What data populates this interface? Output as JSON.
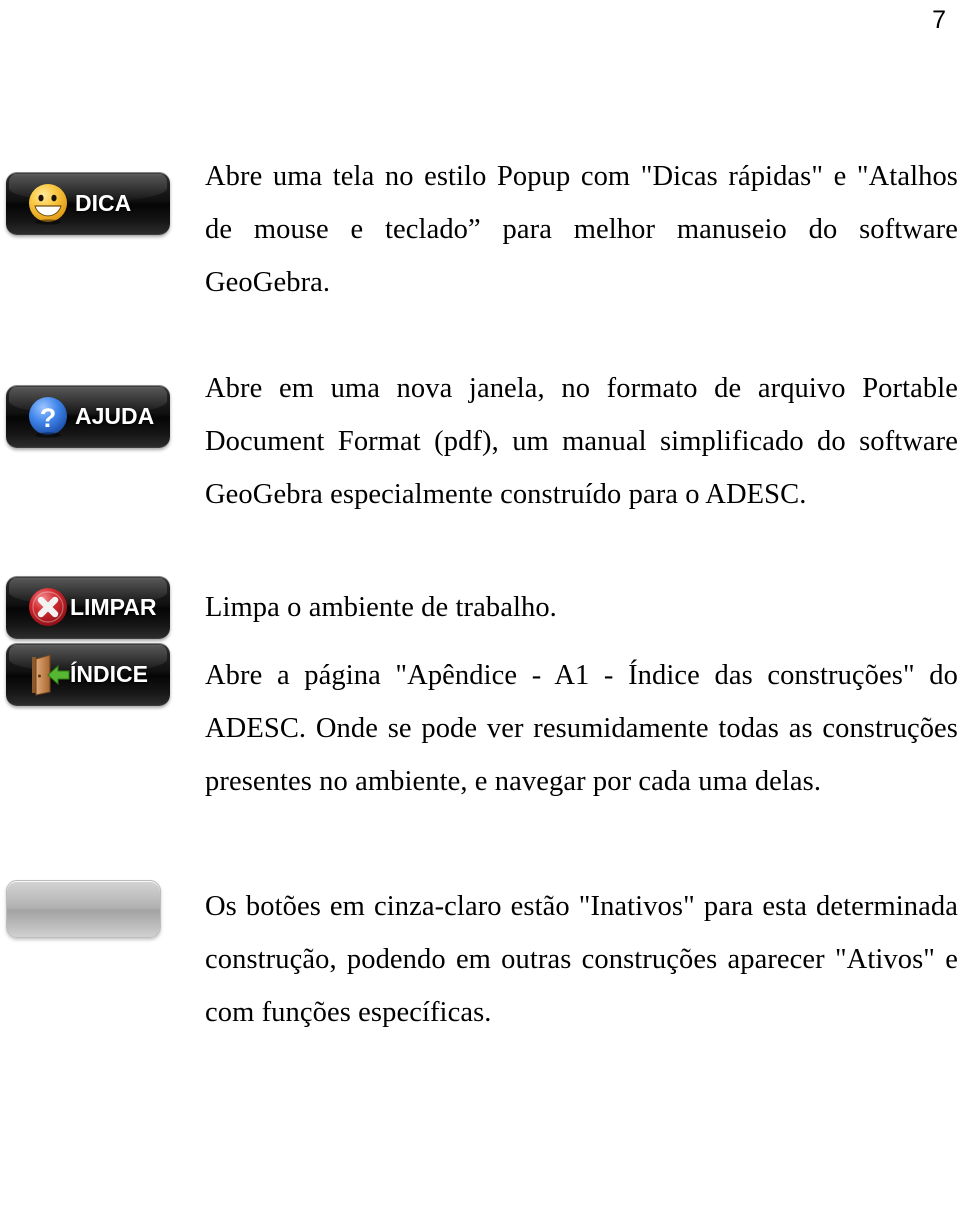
{
  "page": {
    "number": "7"
  },
  "entries": [
    {
      "button": {
        "label": "DICA",
        "icon": "smiley-face-icon",
        "state": "active",
        "colors": {
          "body": "#0d0d0d",
          "icon": "#f5c445",
          "label": "#ffffff"
        }
      },
      "text": "Abre uma tela no estilo Popup com \"Dicas rápidas\" e \"Atalhos de mouse e teclado” para melhor manuseio do software GeoGebra."
    },
    {
      "button": {
        "label": "AJUDA",
        "icon": "question-mark-circle-icon",
        "state": "active",
        "colors": {
          "body": "#0d0d0d",
          "icon": "#3b82e8",
          "label": "#ffffff"
        }
      },
      "text": "Abre em uma nova janela, no formato de arquivo Portable Document Format (pdf), um manual simplificado do software GeoGebra especialmente construído para o ADESC."
    },
    {
      "button": {
        "label": "LIMPAR",
        "icon": "red-x-circle-icon",
        "state": "active",
        "colors": {
          "body": "#0d0d0d",
          "icon": "#cc2229",
          "label": "#ffffff"
        }
      },
      "text": "Limpa o ambiente de trabalho."
    },
    {
      "button": {
        "label": "ÍNDICE",
        "icon": "exit-door-green-arrow-icon",
        "state": "active",
        "colors": {
          "body": "#0d0d0d",
          "icon": "#c98049",
          "arrow": "#5ab83a",
          "label": "#ffffff"
        }
      },
      "text": "Abre a página \"Apêndice - A1 - Índice das construções\" do ADESC. Onde se pode ver resumidamente todas as construções presentes no ambiente, e navegar por cada uma delas."
    },
    {
      "button": {
        "label": "",
        "icon": "blank-button-icon",
        "state": "inactive",
        "colors": {
          "body": "#b8b8b8",
          "label": "#b8b8b8"
        }
      },
      "text": "Os botões em cinza-claro estão \"Inativos\" para esta determinada construção, podendo em outras construções aparecer \"Ativos\" e com funções específicas."
    }
  ]
}
